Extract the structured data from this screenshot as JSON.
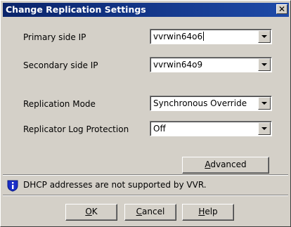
{
  "window": {
    "title": "Change Replication Settings",
    "close_glyph": "✕"
  },
  "fields": {
    "primary_ip": {
      "label": "Primary side IP",
      "value": "vvrwin64o6"
    },
    "secondary_ip": {
      "label": "Secondary side IP",
      "value": "vvrwin64o9"
    },
    "replication_mode": {
      "label": "Replication Mode",
      "value": "Synchronous Override"
    },
    "log_protection": {
      "label": "Replicator Log Protection",
      "value": "Off"
    }
  },
  "buttons": {
    "advanced": {
      "mnemonic": "A",
      "rest": "dvanced"
    },
    "ok": {
      "mnemonic": "O",
      "rest": "K"
    },
    "cancel": {
      "mnemonic": "C",
      "rest": "ancel"
    },
    "help": {
      "mnemonic": "H",
      "rest": "elp"
    }
  },
  "info": {
    "icon": "info-shield-icon",
    "message": "DHCP addresses are not supported by VVR."
  },
  "colors": {
    "titlebar_start": "#0a246a",
    "titlebar_end": "#1e4aa8",
    "dialog_bg": "#d4d0c8",
    "icon_blue": "#1a2ec8"
  }
}
